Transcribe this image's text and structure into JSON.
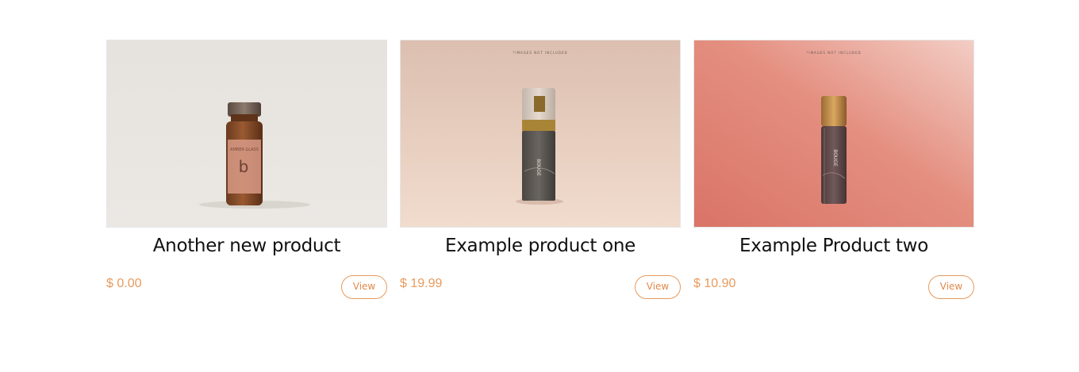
{
  "products": [
    {
      "title": "Another new product",
      "price": "$ 0.00",
      "action": "View"
    },
    {
      "title": "Example product one",
      "price": "$ 19.99",
      "action": "View",
      "image_note": "*IMAGES NOT INCLUDED"
    },
    {
      "title": "Example Product two",
      "price": "$ 10.90",
      "action": "View",
      "image_note": "*IMAGES NOT INCLUDED"
    }
  ],
  "colors": {
    "accent": "#e89a5d",
    "title": "#111111"
  },
  "icons": [
    "amber-vial-image",
    "serum-pump-bottle-image",
    "roller-bottle-image"
  ]
}
